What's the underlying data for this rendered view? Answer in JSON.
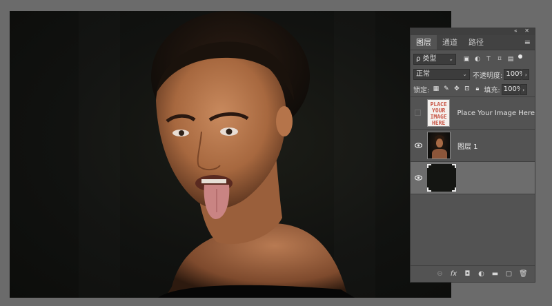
{
  "panel": {
    "topbar_icons": "«  ✕",
    "tabs": [
      {
        "label": "图层"
      },
      {
        "label": "通道"
      },
      {
        "label": "路径"
      }
    ],
    "menu_icon": "≡",
    "filter": {
      "value": "ρ 类型",
      "caret": "⌄"
    },
    "blend": {
      "value": "正常",
      "caret": "⌄"
    },
    "opacity": {
      "label": "不透明度:",
      "value": "100%"
    },
    "lock": {
      "label": "锁定:"
    },
    "fill": {
      "label": "填充:",
      "value": "100%"
    },
    "layers": [
      {
        "name": "Place Your Image Here",
        "visible": false,
        "thumb_text": "PLACE\nYOUR\nIMAGE\nHERE",
        "selected": false
      },
      {
        "name": "图层 1",
        "visible": true,
        "selected": false
      },
      {
        "name": "",
        "visible": true,
        "selected": true
      }
    ],
    "bottom_icons": [
      "link-icon",
      "fx-icon",
      "mask-icon",
      "adjustment-icon",
      "folder-icon",
      "new-layer-icon",
      "trash-icon"
    ],
    "bottom_glyphs": {
      "link": "⊖",
      "fx": "fx",
      "mask": "◘",
      "adj": "◐",
      "folder": "▬",
      "new": "▢",
      "trash": "🗑"
    }
  },
  "colors": {
    "workspace": "#6b6b6b",
    "panel": "#535353",
    "selected_layer": "#6d6d6d",
    "thumb_text": "#c85444"
  }
}
